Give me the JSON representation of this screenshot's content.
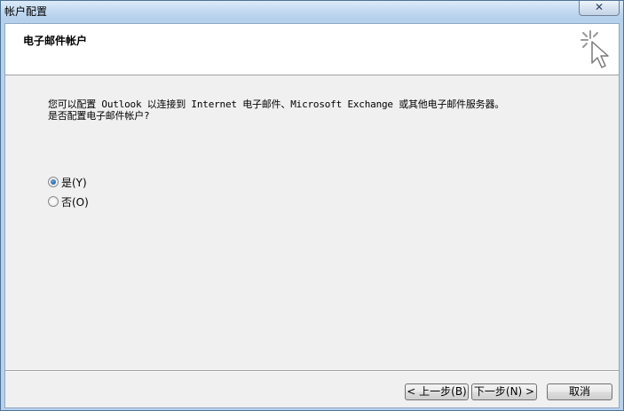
{
  "window": {
    "title": "帐户配置",
    "close_symbol": "✕"
  },
  "header": {
    "title": "电子邮件帐户",
    "icon": "cursor-sparkle-icon"
  },
  "content": {
    "question_line1": "您可以配置 Outlook 以连接到 Internet 电子邮件、Microsoft Exchange 或其他电子邮件服务器。",
    "question_line2": "是否配置电子邮件帐户?",
    "options": [
      {
        "label": "是(Y)",
        "checked": true
      },
      {
        "label": "否(O)",
        "checked": false
      }
    ]
  },
  "buttons": {
    "back_label": "< 上一步(B)",
    "next_label": "下一步(N) >",
    "cancel_label": "取消"
  }
}
